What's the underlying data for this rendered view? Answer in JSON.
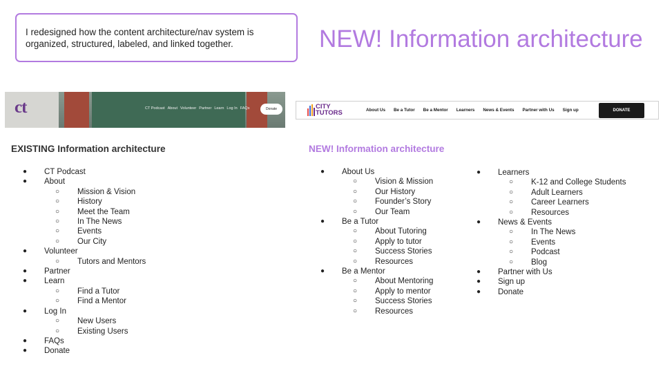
{
  "note": "I redesigned how the content architecture/nav system is organized, structured, labeled, and linked together.",
  "title": "NEW! Information architecture",
  "existing_screenshot": {
    "logo": "ct",
    "nav": [
      "CT Podcast",
      "About",
      "Volunteer",
      "Partner",
      "Learn",
      "Log In",
      "FAQs"
    ],
    "donate": "Donate"
  },
  "new_screenshot": {
    "logo_line1": "CITY",
    "logo_line2": "TUTORS",
    "nav": [
      "About Us",
      "Be a Tutor",
      "Be a Mentor",
      "Learners",
      "News & Events",
      "Partner with Us",
      "Sign up"
    ],
    "donate": "DONATE"
  },
  "existing_heading": "EXISTING Information architecture",
  "new_heading": "NEW! Information architecture",
  "glyphs": {
    "bullet": "●",
    "sub_bullet": "○"
  },
  "existing_ia": [
    {
      "label": "CT Podcast",
      "children": []
    },
    {
      "label": "About",
      "children": [
        "Mission & Vision",
        "History",
        "Meet the Team",
        "In The News",
        "Events",
        "Our City"
      ]
    },
    {
      "label": "Volunteer",
      "children": [
        "Tutors and Mentors"
      ]
    },
    {
      "label": "Partner",
      "children": []
    },
    {
      "label": "Learn",
      "children": [
        "Find a Tutor",
        "Find a Mentor"
      ]
    },
    {
      "label": "Log In",
      "children": [
        "New Users",
        "Existing Users"
      ]
    },
    {
      "label": "FAQs",
      "children": []
    },
    {
      "label": "Donate",
      "children": []
    }
  ],
  "new_ia_col1": [
    {
      "label": "About Us",
      "children": [
        "Vision & Mission",
        "Our History",
        "Founder’s Story",
        "Our Team"
      ]
    },
    {
      "label": "Be a Tutor",
      "children": [
        "About Tutoring",
        "Apply to tutor",
        "Success Stories",
        "Resources"
      ]
    },
    {
      "label": "Be a Mentor",
      "children": [
        "About Mentoring",
        "Apply to mentor",
        "Success Stories",
        "Resources"
      ]
    }
  ],
  "new_ia_col2": [
    {
      "label": "Learners",
      "children": [
        "K-12 and College Students",
        "Adult Learners",
        "Career Learners",
        "Resources"
      ]
    },
    {
      "label": "News & Events",
      "children": [
        "In The News",
        "Events",
        "Podcast",
        "Blog"
      ]
    },
    {
      "label": "Partner with Us",
      "children": []
    },
    {
      "label": "Sign up",
      "children": []
    },
    {
      "label": "Donate",
      "children": []
    }
  ]
}
